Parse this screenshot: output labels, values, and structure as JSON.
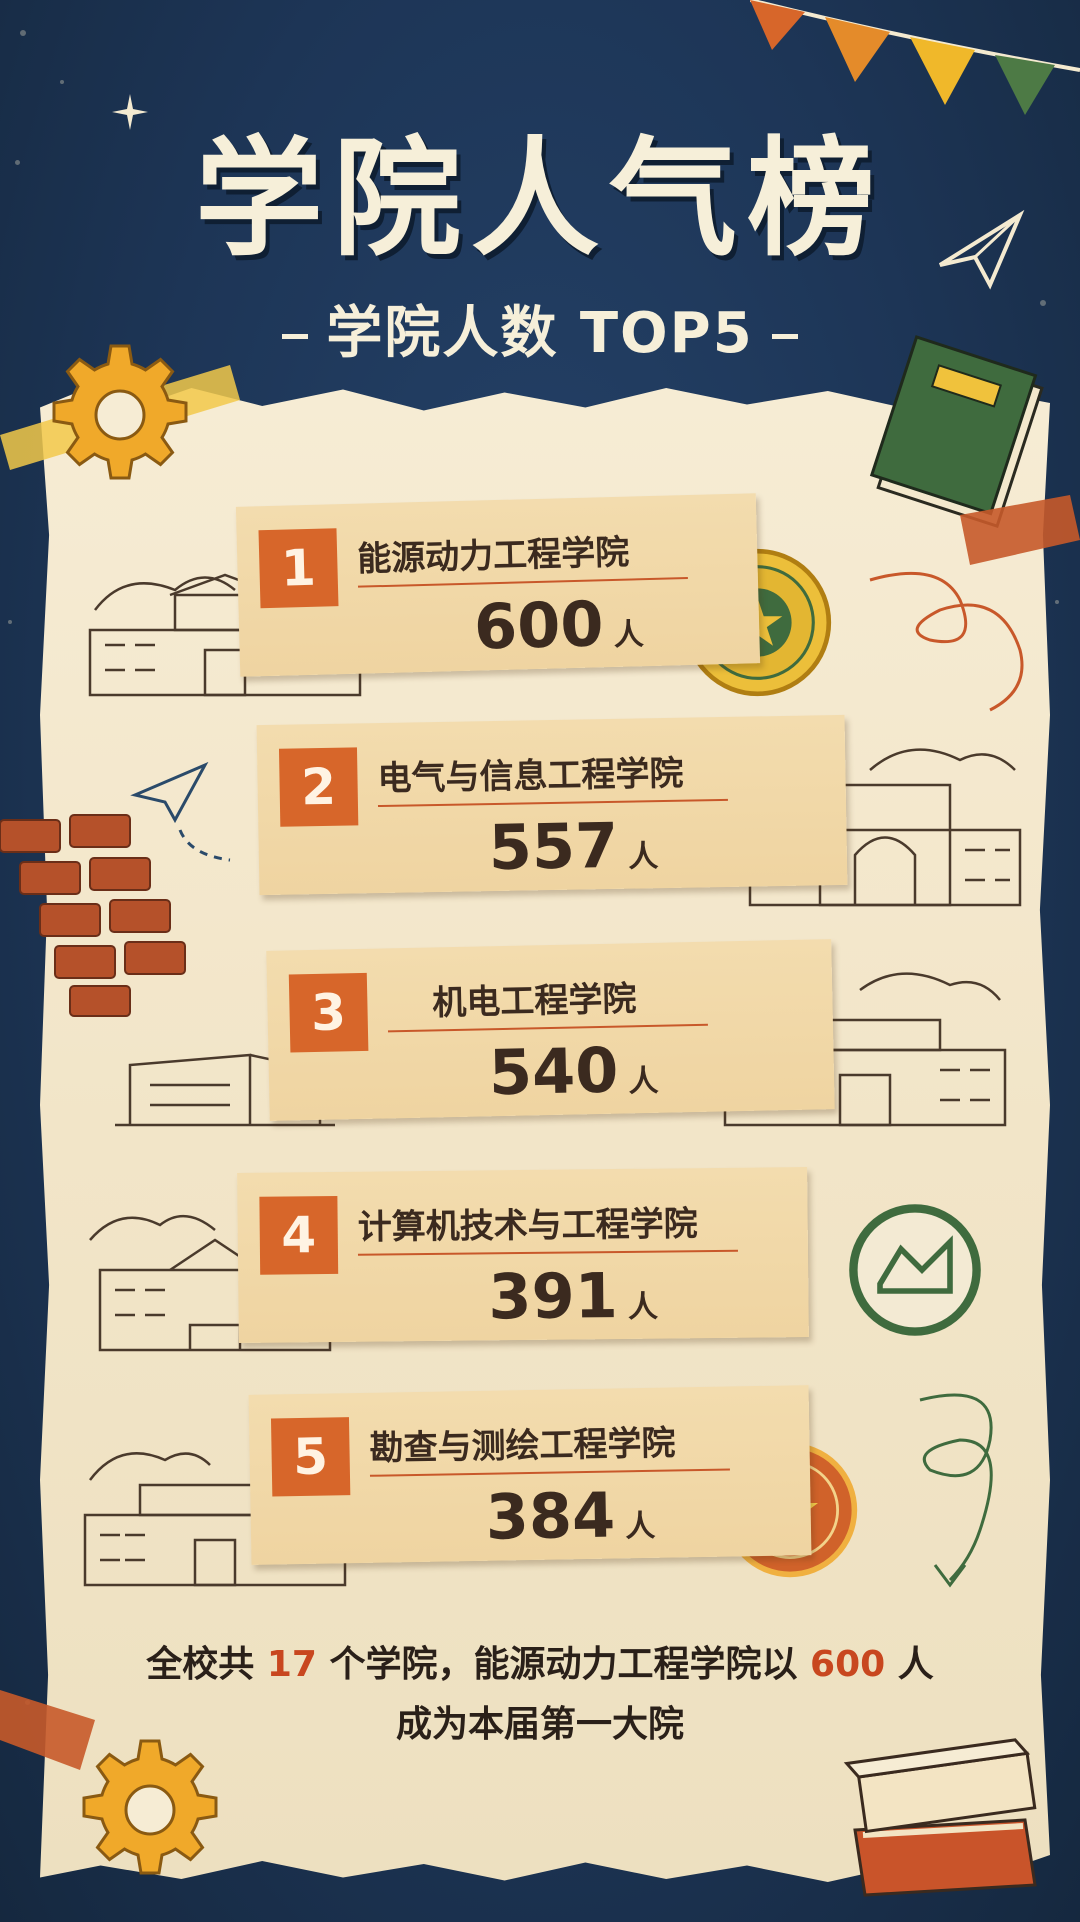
{
  "header": {
    "title": "学院人气榜",
    "subtitle": "学院人数 TOP5"
  },
  "ranking": [
    {
      "rank": "1",
      "college": "能源动力工程学院",
      "count": "600",
      "unit": "人"
    },
    {
      "rank": "2",
      "college": "电气与信息工程学院",
      "count": "557",
      "unit": "人"
    },
    {
      "rank": "3",
      "college": "机电工程学院",
      "count": "540",
      "unit": "人"
    },
    {
      "rank": "4",
      "college": "计算机技术与工程学院",
      "count": "391",
      "unit": "人"
    },
    {
      "rank": "5",
      "college": "勘查与测绘工程学院",
      "count": "384",
      "unit": "人"
    }
  ],
  "summary": {
    "line1_prefix": "全校共",
    "total_colleges": "17",
    "line1_middle": "个学院，能源动力工程学院以",
    "top_count": "600",
    "line1_suffix": "人",
    "line2": "成为本届第一大院"
  },
  "colors": {
    "background": "#1d3556",
    "paper": "#f3e7cb",
    "card": "#f0d6a4",
    "accent": "#d7662a",
    "gear": "#f0a92a",
    "book_green": "#3f6b3e"
  },
  "icons": [
    "gear-icon",
    "book-icon",
    "paper-plane-icon",
    "brick-wall-icon",
    "seal-icon",
    "building-icon",
    "bunting-icon",
    "books-stack-icon",
    "smiley-icon",
    "envelope-icon"
  ]
}
